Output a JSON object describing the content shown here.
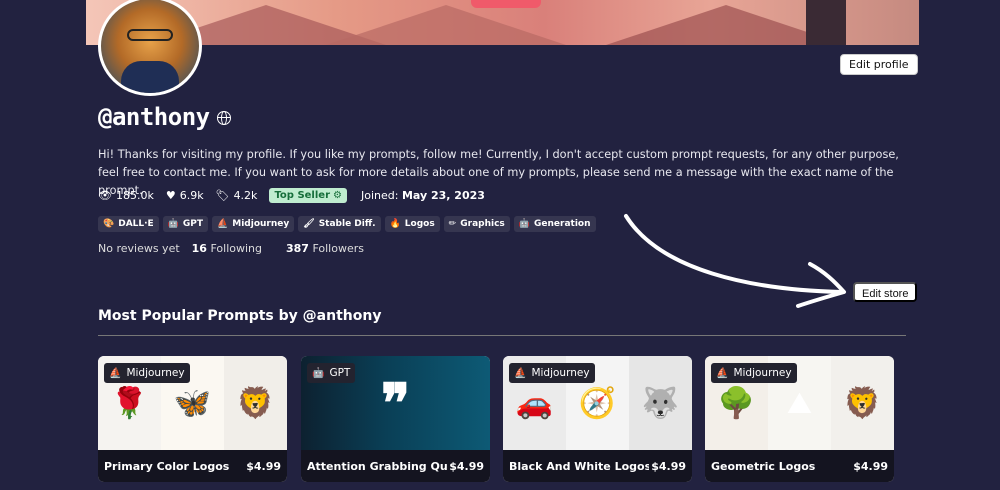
{
  "profile": {
    "username": "@anthony",
    "edit_profile_label": "Edit profile",
    "bio": "Hi! Thanks for visiting my profile. If you like my prompts, follow me! Currently, I don't accept custom prompt requests, for any other purpose, feel free to contact me. If you want to ask for more details about one of my prompts, please send me a message with the exact name of the prompt.",
    "stats": {
      "views": "185.0k",
      "likes": "6.9k",
      "tags": "4.2k"
    },
    "badge": "Top Seller",
    "joined_label": "Joined:",
    "joined_date": "May 23, 2023",
    "tags": [
      {
        "label": "DALL·E",
        "icon": "palette-icon"
      },
      {
        "label": "GPT",
        "icon": "robot-icon"
      },
      {
        "label": "Midjourney",
        "icon": "sail-icon"
      },
      {
        "label": "Stable Diff.",
        "icon": "brush-icon"
      },
      {
        "label": "Logos",
        "icon": "logo-icon"
      },
      {
        "label": "Graphics",
        "icon": "pencil-icon"
      },
      {
        "label": "Generation",
        "icon": "robot-icon"
      }
    ],
    "reviews": "No reviews yet",
    "following_count": "16",
    "following_label": "Following",
    "followers_count": "387",
    "followers_label": "Followers"
  },
  "store": {
    "edit_store_label": "Edit store"
  },
  "section": {
    "title": "Most Popular Prompts by @anthony"
  },
  "cards": [
    {
      "chip": "Midjourney",
      "name": "Primary Color Logos",
      "price": "$4.99",
      "icons": [
        "🌹",
        "🦋",
        "🦁"
      ]
    },
    {
      "chip": "GPT",
      "name": "Attention Grabbing Quotes O...",
      "price": "$4.99"
    },
    {
      "chip": "Midjourney",
      "name": "Black And White Logos",
      "price": "$4.99",
      "icons": [
        "🚗",
        "🧭",
        "🐺"
      ]
    },
    {
      "chip": "Midjourney",
      "name": "Geometric Logos",
      "price": "$4.99",
      "icons": [
        "🌳",
        "⛰",
        "🦁"
      ]
    }
  ],
  "colors": {
    "background": "#222240",
    "badge_bg": "#bfeccf",
    "badge_text": "#166e3a",
    "card_bar": "#141420"
  }
}
